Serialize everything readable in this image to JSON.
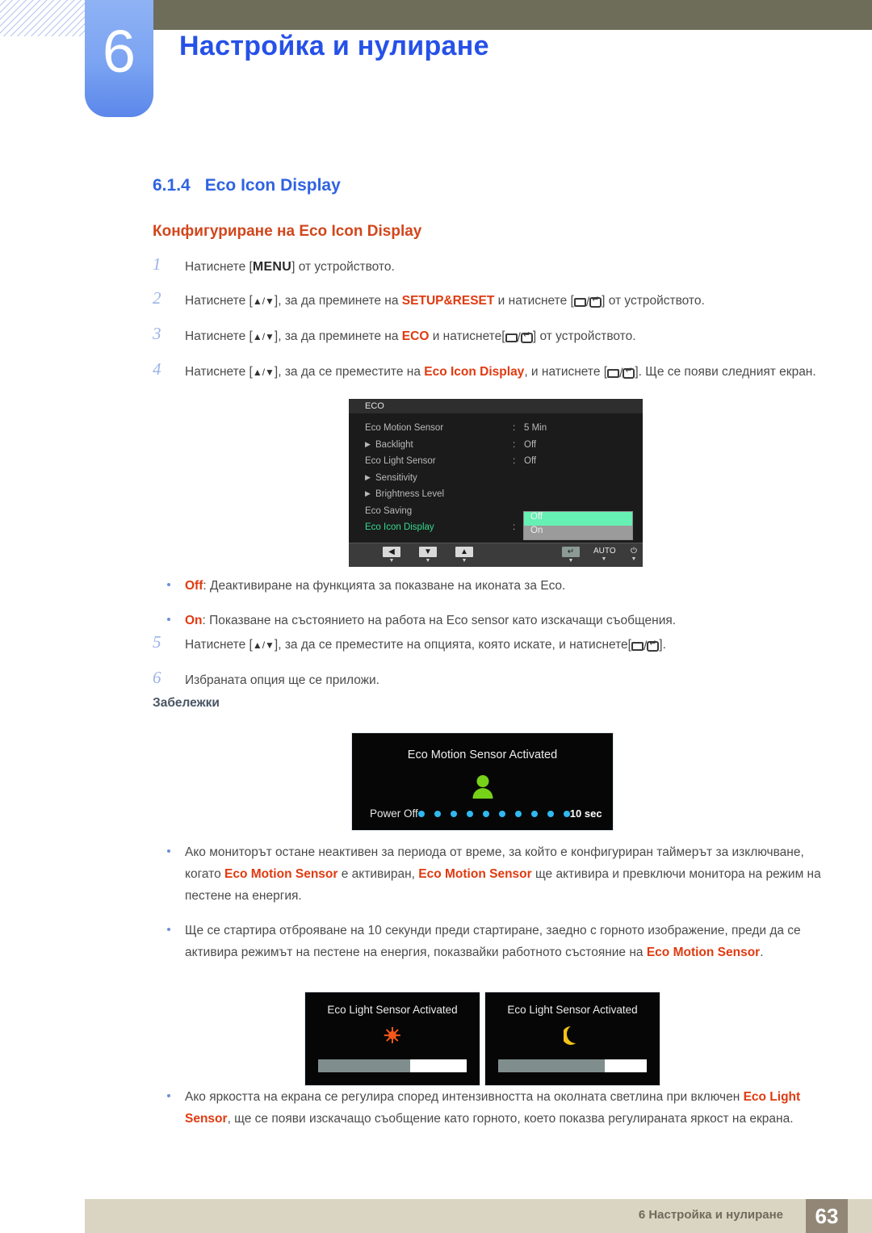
{
  "header": {
    "chapter_number": "6",
    "chapter_title": "Настройка и нулиране"
  },
  "section": {
    "number": "6.1.4",
    "title": "Eco Icon Display",
    "subtitle": "Конфигуриране на Eco Icon Display"
  },
  "steps": [
    {
      "n": "1",
      "parts": [
        {
          "t": "text",
          "v": "Натиснете ["
        },
        {
          "t": "menu",
          "v": "MENU"
        },
        {
          "t": "text",
          "v": "] от устройството."
        }
      ]
    },
    {
      "n": "2",
      "parts": [
        {
          "t": "text",
          "v": "Натиснете ["
        },
        {
          "t": "updown",
          "v": "▲/▼"
        },
        {
          "t": "text",
          "v": "], за да преминете на "
        },
        {
          "t": "red",
          "v": "SETUP&RESET"
        },
        {
          "t": "text",
          "v": " и натиснете ["
        },
        {
          "t": "keys",
          "v": "▭/⏎"
        },
        {
          "t": "text",
          "v": "] от устройството."
        }
      ]
    },
    {
      "n": "3",
      "parts": [
        {
          "t": "text",
          "v": "Натиснете ["
        },
        {
          "t": "updown",
          "v": "▲/▼"
        },
        {
          "t": "text",
          "v": "], за да преминете на "
        },
        {
          "t": "red",
          "v": "ECO"
        },
        {
          "t": "text",
          "v": " и натиснете["
        },
        {
          "t": "keys",
          "v": "▭/⏎"
        },
        {
          "t": "text",
          "v": "] от устройството."
        }
      ]
    },
    {
      "n": "4",
      "parts": [
        {
          "t": "text",
          "v": "Натиснете ["
        },
        {
          "t": "updown",
          "v": "▲/▼"
        },
        {
          "t": "text",
          "v": "], за да се преместите на "
        },
        {
          "t": "red",
          "v": "Eco Icon Display"
        },
        {
          "t": "text",
          "v": ", и натиснете ["
        },
        {
          "t": "keys",
          "v": "▭/⏎"
        },
        {
          "t": "text",
          "v": "]. Ще се появи следният екран."
        }
      ]
    }
  ],
  "osd": {
    "title": "ECO",
    "rows": [
      {
        "label": "Eco Motion Sensor",
        "arrow": false,
        "colon": ":",
        "value": "5 Min",
        "selected": false
      },
      {
        "label": "Backlight",
        "arrow": true,
        "colon": ":",
        "value": "Off",
        "selected": false
      },
      {
        "label": "Eco Light Sensor",
        "arrow": false,
        "colon": ":",
        "value": "Off",
        "selected": false
      },
      {
        "label": "Sensitivity",
        "arrow": true,
        "colon": "",
        "value": "",
        "selected": false
      },
      {
        "label": "Brightness Level",
        "arrow": true,
        "colon": "",
        "value": "",
        "selected": false
      },
      {
        "label": "Eco Saving",
        "arrow": false,
        "colon": "",
        "value": "",
        "selected": false
      },
      {
        "label": "Eco Icon Display",
        "arrow": false,
        "colon": ":",
        "value": "",
        "selected": true
      }
    ],
    "popup": {
      "options": [
        "Off",
        "On"
      ],
      "highlighted": "Off",
      "highlight_color": "#66f0b4"
    },
    "footer_buttons": [
      {
        "name": "left-arrow",
        "glyph": "◀"
      },
      {
        "name": "down-arrow",
        "glyph": "▼"
      },
      {
        "name": "up-arrow",
        "glyph": "▲"
      },
      {
        "name": "enter",
        "glyph": "↵"
      },
      {
        "name": "auto",
        "glyph": "AUTO"
      },
      {
        "name": "power",
        "glyph": "⏻"
      }
    ]
  },
  "option_bullets": [
    {
      "parts": [
        {
          "t": "red",
          "v": "Off"
        },
        {
          "t": "text",
          "v": ": Деактивиране на функцията за показване на иконата за Eco."
        }
      ]
    },
    {
      "parts": [
        {
          "t": "red",
          "v": "On"
        },
        {
          "t": "text",
          "v": ": Показване на състоянието на работа на Eco sensor като изскачащи съобщения."
        }
      ]
    }
  ],
  "steps2": [
    {
      "n": "5",
      "parts": [
        {
          "t": "text",
          "v": "Натиснете ["
        },
        {
          "t": "updown",
          "v": "▲/▼"
        },
        {
          "t": "text",
          "v": "], за да се преместите на опцията, която искате, и натиснете["
        },
        {
          "t": "keys",
          "v": "▭/⏎"
        },
        {
          "t": "text",
          "v": "]."
        }
      ]
    },
    {
      "n": "6",
      "parts": [
        {
          "t": "text",
          "v": "Избраната опция ще се приложи."
        }
      ]
    }
  ],
  "notes": {
    "heading": "Забележки"
  },
  "popup_motion": {
    "title": "Eco Motion Sensor Activated",
    "power_label": "Power Off",
    "seconds_label": "10 sec",
    "dot_count": 10,
    "dot_color": "#2fb9f0",
    "icon": "person-icon",
    "icon_color": "#76d118"
  },
  "popup_light": [
    {
      "title": "Eco Light Sensor Activated",
      "icon": "sun-icon",
      "icon_color": "#f4571a",
      "bar_fill_percent": 62
    },
    {
      "title": "Eco Light Sensor Activated",
      "icon": "moon-icon",
      "icon_color": "#f2c318",
      "bar_fill_percent": 72
    }
  ],
  "note_bullets": [
    {
      "parts": [
        {
          "t": "text",
          "v": "Ако мониторът остане неактивен за периода от време, за който е конфигуриран таймерът за изключване, когато "
        },
        {
          "t": "red",
          "v": "Eco Motion Sensor"
        },
        {
          "t": "text",
          "v": " е активиран, "
        },
        {
          "t": "red",
          "v": "Eco Motion Sensor"
        },
        {
          "t": "text",
          "v": " ще активира и превключи монитора на режим на пестене на енергия."
        }
      ]
    },
    {
      "parts": [
        {
          "t": "text",
          "v": "Ще се стартира отброяване на 10 секунди преди стартиране, заедно с горното изображение, преди да се активира режимът на пестене на енергия, показвайки работното състояние на "
        },
        {
          "t": "red",
          "v": "Eco Motion Sensor"
        },
        {
          "t": "text",
          "v": "."
        }
      ]
    }
  ],
  "note_bullets_bottom": [
    {
      "parts": [
        {
          "t": "text",
          "v": "Ако яркостта на екрана се регулира според интензивността на околната светлина при включен "
        },
        {
          "t": "red",
          "v": "Eco Light Sensor"
        },
        {
          "t": "text",
          "v": ", ще се появи изскачащо съобщение като горното, което показва регулираната яркост на екрана."
        }
      ]
    }
  ],
  "footer": {
    "text": "6 Настройка и нулиране",
    "page_number": "63"
  }
}
